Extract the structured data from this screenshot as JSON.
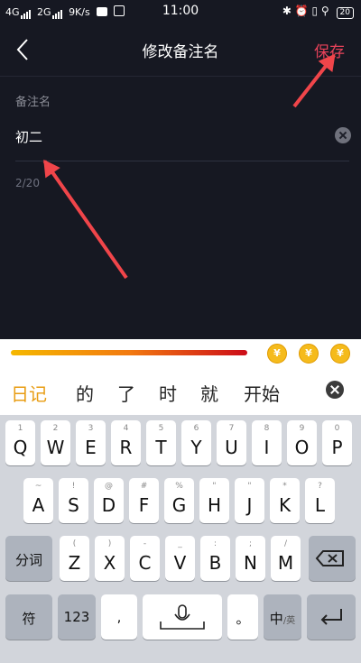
{
  "status": {
    "signal1": "4G",
    "signal2": "2G",
    "speed": "9K/s",
    "time": "11:00",
    "battery": "20"
  },
  "nav": {
    "title": "修改备注名",
    "save": "保存"
  },
  "form": {
    "label": "备注名",
    "value": "初二",
    "counter": "2/20"
  },
  "ime": {
    "coin_symbol": "¥",
    "candidates": [
      "日记",
      "的",
      "了",
      "时",
      "就",
      "开始"
    ]
  },
  "keys": {
    "row1": [
      {
        "ch": "Q",
        "sub": "1"
      },
      {
        "ch": "W",
        "sub": "2"
      },
      {
        "ch": "E",
        "sub": "3"
      },
      {
        "ch": "R",
        "sub": "4"
      },
      {
        "ch": "T",
        "sub": "5"
      },
      {
        "ch": "Y",
        "sub": "6"
      },
      {
        "ch": "U",
        "sub": "7"
      },
      {
        "ch": "I",
        "sub": "8"
      },
      {
        "ch": "O",
        "sub": "9"
      },
      {
        "ch": "P",
        "sub": "0"
      }
    ],
    "row2": [
      {
        "ch": "A",
        "sub": "~"
      },
      {
        "ch": "S",
        "sub": "!"
      },
      {
        "ch": "D",
        "sub": "@"
      },
      {
        "ch": "F",
        "sub": "#"
      },
      {
        "ch": "G",
        "sub": "%"
      },
      {
        "ch": "H",
        "sub": "\""
      },
      {
        "ch": "J",
        "sub": "\""
      },
      {
        "ch": "K",
        "sub": "*"
      },
      {
        "ch": "L",
        "sub": "?"
      }
    ],
    "row3": [
      {
        "ch": "Z",
        "sub": "("
      },
      {
        "ch": "X",
        "sub": ")"
      },
      {
        "ch": "C",
        "sub": "-"
      },
      {
        "ch": "V",
        "sub": "_"
      },
      {
        "ch": "B",
        "sub": ":"
      },
      {
        "ch": "N",
        "sub": ";"
      },
      {
        "ch": "M",
        "sub": "/"
      }
    ],
    "fenci": "分词",
    "symbols": "符",
    "numbers": "123",
    "comma": ",",
    "period": "。",
    "lang_main": "中",
    "lang_alt": "/英"
  },
  "colors": {
    "background": "#161822",
    "accent": "#e8425a",
    "arrow": "#f0454a",
    "candidate_highlight": "#e89c12"
  }
}
